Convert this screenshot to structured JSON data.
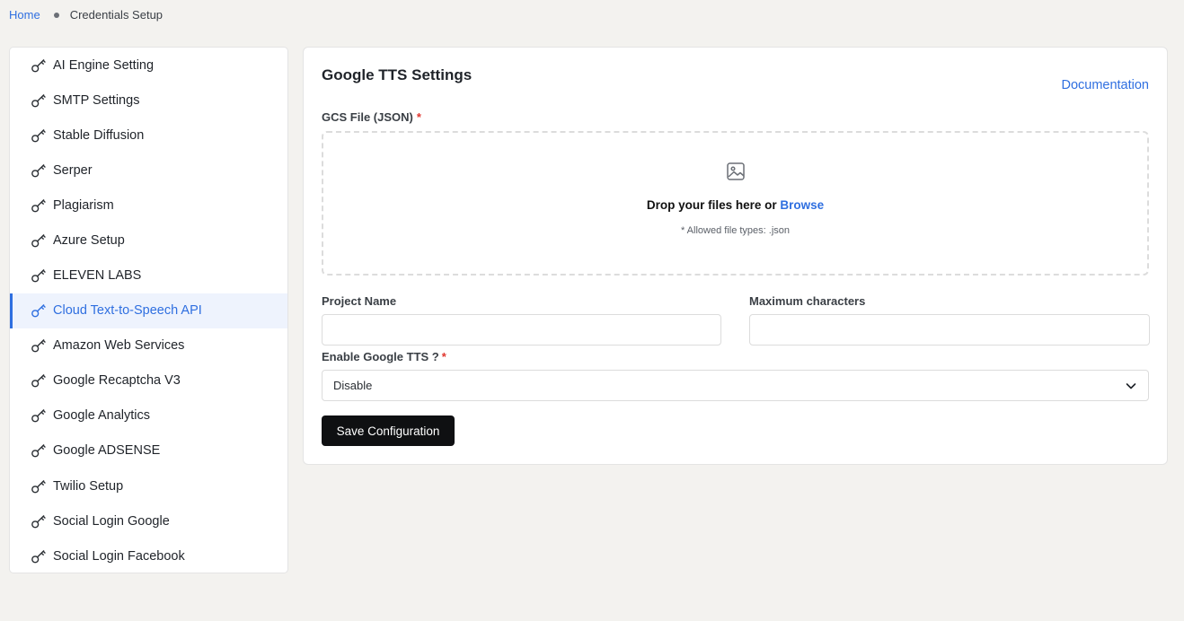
{
  "breadcrumb": {
    "home": "Home",
    "current": "Credentials Setup"
  },
  "sidebar": {
    "active_index": 7,
    "items": [
      {
        "label": "AI Engine Setting",
        "icon": "key-icon"
      },
      {
        "label": "SMTP Settings",
        "icon": "key-icon"
      },
      {
        "label": "Stable Diffusion",
        "icon": "key-icon"
      },
      {
        "label": "Serper",
        "icon": "key-icon"
      },
      {
        "label": "Plagiarism",
        "icon": "key-icon"
      },
      {
        "label": "Azure Setup",
        "icon": "key-icon"
      },
      {
        "label": "ELEVEN LABS",
        "icon": "key-icon"
      },
      {
        "label": "Cloud Text-to-Speech API",
        "icon": "key-icon"
      },
      {
        "label": "Amazon Web Services",
        "icon": "key-icon"
      },
      {
        "label": "Google Recaptcha V3",
        "icon": "key-icon"
      },
      {
        "label": "Google Analytics",
        "icon": "key-icon"
      },
      {
        "label": "Google ADSENSE",
        "icon": "key-icon"
      },
      {
        "label": "Twilio Setup",
        "icon": "key-icon"
      },
      {
        "label": "Social Login Google",
        "icon": "key-icon"
      },
      {
        "label": "Social Login Facebook",
        "icon": "key-icon"
      }
    ]
  },
  "panel": {
    "title": "Google TTS Settings",
    "documentation": "Documentation",
    "gcs_label": "GCS File (JSON)",
    "required_mark": "*",
    "dropzone": {
      "text": "Drop your files here or",
      "browse": "Browse",
      "hint": "* Allowed file types: .json"
    },
    "project_name": {
      "label": "Project Name",
      "value": "",
      "placeholder": ""
    },
    "max_chars": {
      "label": "Maximum characters",
      "value": "",
      "placeholder": ""
    },
    "enable": {
      "label": "Enable Google TTS ?",
      "selected": "Disable"
    },
    "save_label": "Save Configuration"
  },
  "colors": {
    "accent": "#2f6fe0",
    "required": "#e0372f",
    "button": "#0f1012"
  }
}
